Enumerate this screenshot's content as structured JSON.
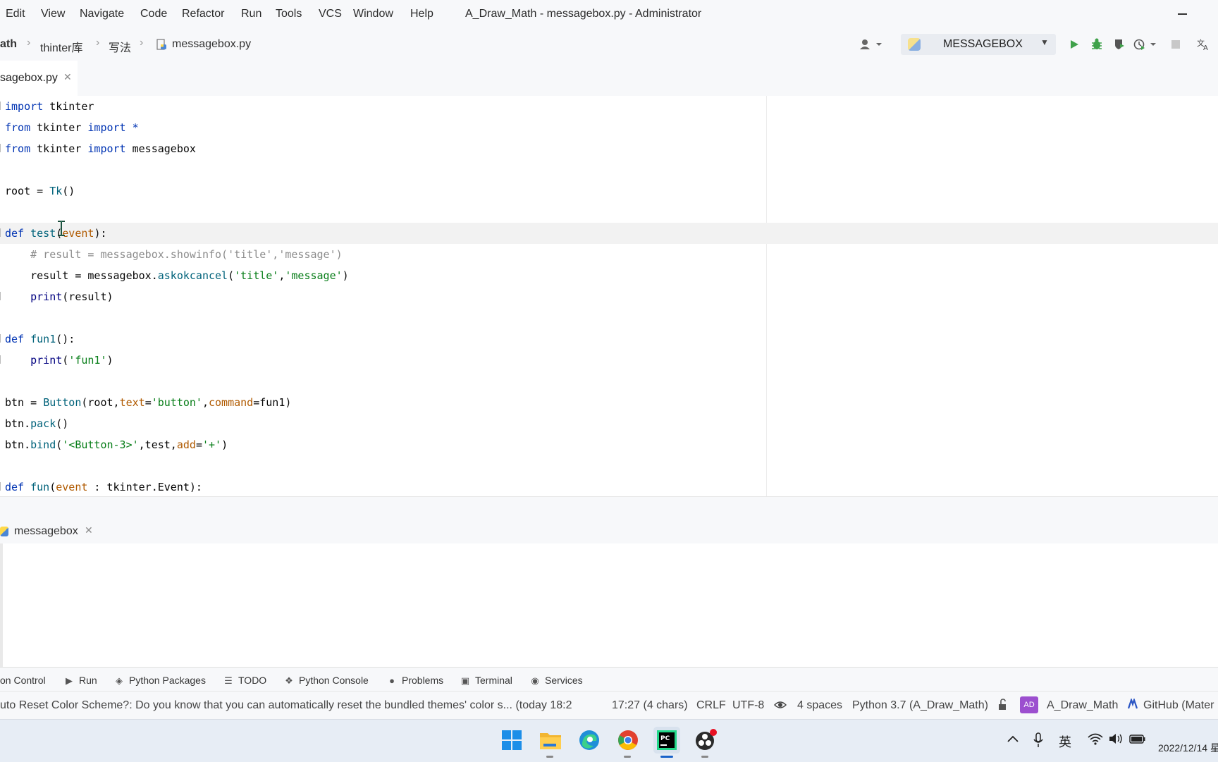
{
  "menu": {
    "items": [
      "Edit",
      "View",
      "Navigate",
      "Code",
      "Refactor",
      "Run",
      "Tools",
      "VCS",
      "Window",
      "Help"
    ],
    "window_title": "A_Draw_Math - messagebox.py - Administrator"
  },
  "nav": {
    "project_crumb": "ath",
    "crumbs": [
      "thinter库",
      "写法",
      "messagebox.py"
    ],
    "run_config": "MESSAGEBOX"
  },
  "file_tab": {
    "label": "sagebox.py"
  },
  "code": {
    "l1": [
      "import",
      " tkinter"
    ],
    "l2": [
      "from",
      " tkinter ",
      "import",
      " *"
    ],
    "l3": [
      "from",
      " tkinter ",
      "import",
      " messagebox"
    ],
    "l5": [
      "root",
      " = ",
      "Tk",
      "()"
    ],
    "l7": [
      "def",
      " test",
      "(",
      "event",
      "):"
    ],
    "l8": "    # result = messagebox.showinfo('title','message')",
    "l9": [
      "    result = messagebox.",
      "askokcancel",
      "(",
      "'title'",
      ",",
      "'message'",
      ")"
    ],
    "l10": [
      "    ",
      "print",
      "(result)"
    ],
    "l12": [
      "def",
      " fun1",
      "():"
    ],
    "l13": [
      "    ",
      "print",
      "(",
      "'fun1'",
      ")"
    ],
    "l15": [
      "btn",
      " = ",
      "Button",
      "(root,",
      "text",
      "=",
      "'button'",
      ",",
      "command",
      "=fun1)"
    ],
    "l16": [
      "btn.",
      "pack",
      "()"
    ],
    "l17": [
      "btn.",
      "bind",
      "(",
      "'<Button-3>'",
      ",test,",
      "add",
      "=",
      "'+'",
      ")"
    ],
    "l19": [
      "def",
      " fun",
      "(",
      "event",
      " : tkinter.",
      "Event",
      "):"
    ]
  },
  "run_panel": {
    "tab_label": "messagebox"
  },
  "tool_tabs": {
    "vcs": "on Control",
    "run": "Run",
    "packages": "Python Packages",
    "todo": "TODO",
    "console": "Python Console",
    "problems": "Problems",
    "terminal": "Terminal",
    "services": "Services"
  },
  "status": {
    "message": "uto Reset Color Scheme?: Do you know that you can automatically reset the bundled themes' color s... (today 18:2",
    "position": "17:27 (4 chars)",
    "line_sep": "CRLF",
    "encoding": "UTF-8",
    "indent": "4 spaces",
    "interpreter": "Python 3.7 (A_Draw_Math)",
    "ad_badge": "AD",
    "project": "A_Draw_Math",
    "github": "GitHub (Mater"
  },
  "taskbar": {
    "ime": "英",
    "clock": "2022/12/14 星"
  },
  "colors": {
    "keyword": "#0033b3",
    "string": "#067d17",
    "comment": "#8c8c8c",
    "param": "#b05a00",
    "accent_run_tab": "#4cbb5d"
  }
}
